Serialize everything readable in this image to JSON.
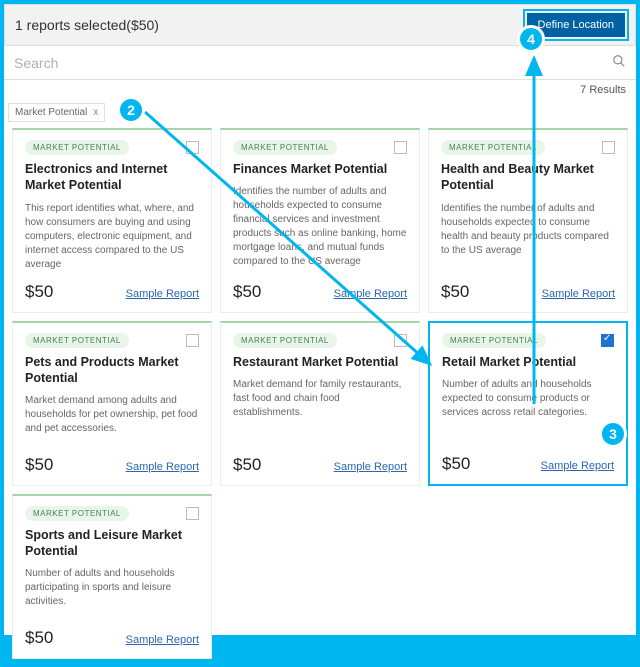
{
  "header": {
    "selected_text": "1 reports selected($50)",
    "define_button": "Define Location"
  },
  "search": {
    "placeholder": "Search"
  },
  "results_text": "7 Results",
  "chip": {
    "label": "Market Potential",
    "close": "x"
  },
  "cards": [
    {
      "tag": "MARKET POTENTIAL",
      "title": "Electronics and Internet Market Potential",
      "desc": "This report identifies what, where, and how consumers are buying and using computers, electronic equipment, and internet access compared to the US average",
      "price": "$50",
      "link": "Sample Report",
      "checked": false
    },
    {
      "tag": "MARKET POTENTIAL",
      "title": "Finances Market Potential",
      "desc": "Identifies the number of adults and households expected to consume financial services and investment products such as online banking, home mortgage loans, and mutual funds compared to the US average",
      "price": "$50",
      "link": "Sample Report",
      "checked": false
    },
    {
      "tag": "MARKET POTENTIAL",
      "title": "Health and Beauty Market Potential",
      "desc": "Identifies the number of adults and households expected to consume health and beauty products compared to the US average",
      "price": "$50",
      "link": "Sample Report",
      "checked": false
    },
    {
      "tag": "MARKET POTENTIAL",
      "title": "Pets and Products Market Potential",
      "desc": "Market demand among adults and households for pet ownership, pet food and pet accessories.",
      "price": "$50",
      "link": "Sample Report",
      "checked": false
    },
    {
      "tag": "MARKET POTENTIAL",
      "title": "Restaurant Market Potential",
      "desc": "Market demand for family restaurants, fast food and chain food establishments.",
      "price": "$50",
      "link": "Sample Report",
      "checked": false
    },
    {
      "tag": "MARKET POTENTIAL",
      "title": "Retail Market Potential",
      "desc": "Number of adults and households expected to consume products or services across retail categories.",
      "price": "$50",
      "link": "Sample Report",
      "checked": true
    },
    {
      "tag": "MARKET POTENTIAL",
      "title": "Sports and Leisure Market Potential",
      "desc": "Number of adults and households participating in sports and leisure activities.",
      "price": "$50",
      "link": "Sample Report",
      "checked": false
    }
  ],
  "badges": {
    "b2": "2",
    "b3": "3",
    "b4": "4"
  }
}
